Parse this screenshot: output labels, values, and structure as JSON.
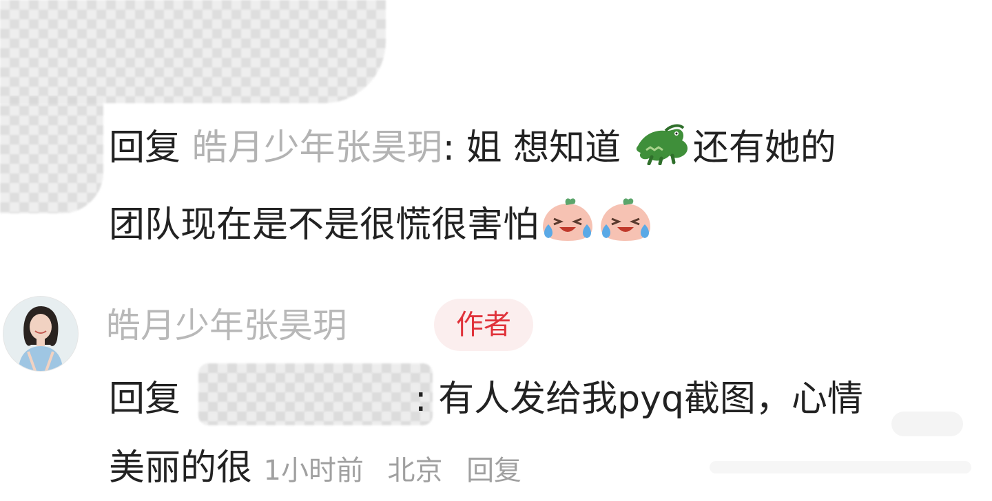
{
  "reply_to_comment": {
    "reply_prefix": "回复",
    "mention_name": "皓月少年张昊玥",
    "text_part_1": ": 姐 想知道",
    "text_part_2": "还有她的",
    "text_line_2": "团队现在是不是很慌很害怕",
    "emojis": [
      "crocodile-emoji",
      "crying-laugh-emoji",
      "crying-laugh-emoji"
    ]
  },
  "author_reply": {
    "username": "皓月少年张昊玥",
    "badge": "作者",
    "reply_prefix": "回复",
    "text_line_1": ": 有人发给我pyq截图，心情",
    "text_line_2": "美丽的很",
    "time": "1小时前",
    "location": "北京",
    "reply_action": "回复"
  }
}
